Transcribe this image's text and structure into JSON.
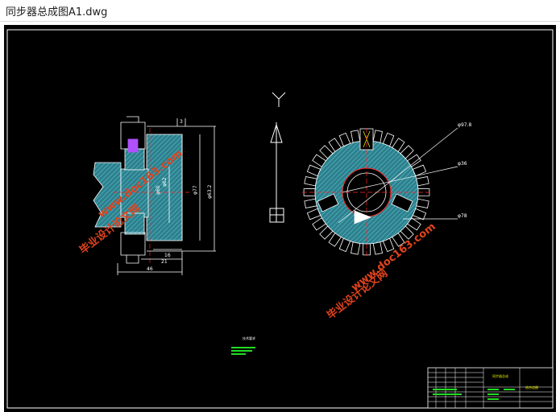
{
  "window": {
    "title": "同步器总成图A1.dwg"
  },
  "drawing": {
    "colors": {
      "background": "#000000",
      "lines": "#ffffff",
      "hatch": "#4db3c4",
      "red": "#ff2a2a",
      "green": "#22dd22",
      "purple": "#b050ff",
      "yellow": "#e8e800",
      "watermark": "#e0431e"
    },
    "left_view": {
      "dims": [
        "φ63.2",
        "φ77",
        "φ62",
        "φ60",
        "16",
        "21",
        "46",
        "3"
      ]
    },
    "right_view": {
      "dims": [
        "φ97.8",
        "φ36",
        "φ78"
      ],
      "ucs_label": "Y"
    },
    "notes": {
      "heading": "技术要求"
    },
    "title_block": {
      "name": "同步器总成",
      "part": "结合齿圈"
    },
    "watermark": {
      "brand": "毕业设计论文网",
      "url": "www.doc163.com"
    }
  }
}
